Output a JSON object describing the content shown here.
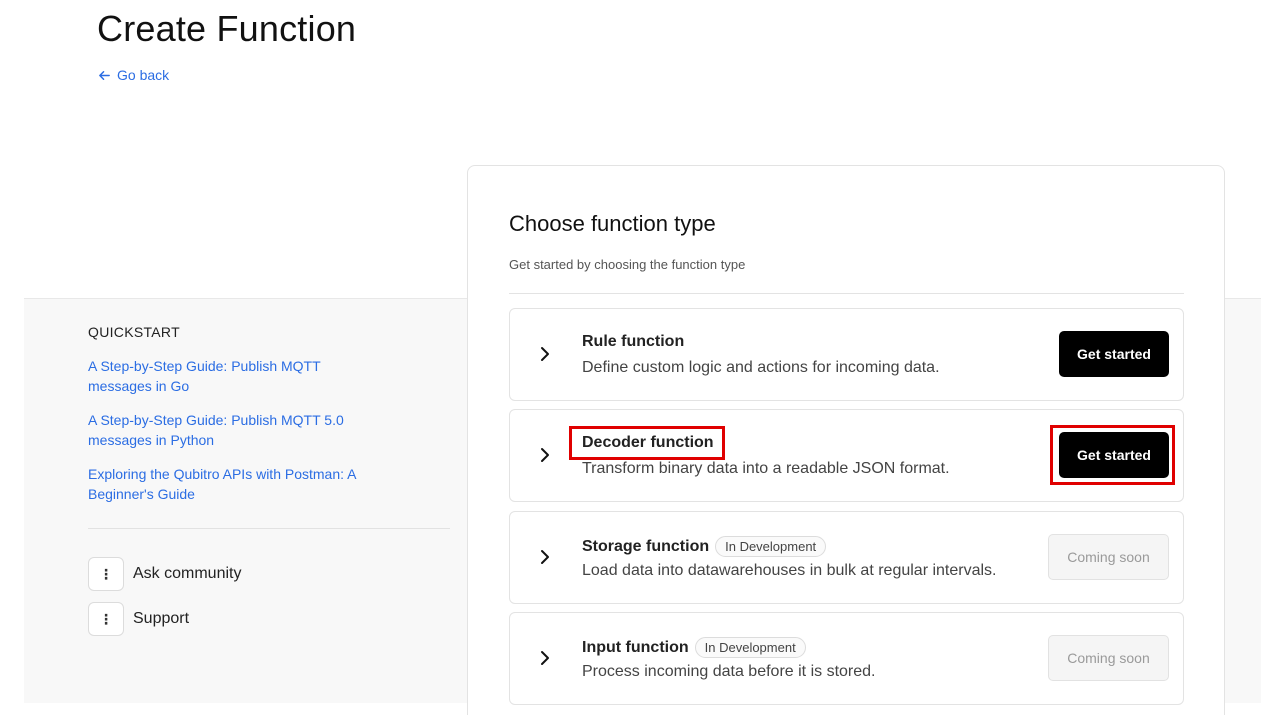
{
  "header": {
    "title": "Create Function",
    "go_back": "Go back"
  },
  "sidebar": {
    "quickstart_heading": "QUICKSTART",
    "links": [
      "A Step-by-Step Guide: Publish MQTT messages in Go",
      "A Step-by-Step Guide: Publish MQTT 5.0 messages in Python",
      "Exploring the Qubitro APIs with Postman: A Beginner's Guide"
    ],
    "actions": [
      {
        "label": "Ask community",
        "icon": "more-vertical-icon"
      },
      {
        "label": "Support",
        "icon": "more-vertical-icon"
      }
    ]
  },
  "card": {
    "title": "Choose function type",
    "subtitle": "Get started by choosing the function type",
    "functions": [
      {
        "title": "Rule function",
        "description": "Define custom logic and actions for incoming data.",
        "badge": "",
        "button": "Get started",
        "enabled": true
      },
      {
        "title": "Decoder function",
        "description": "Transform binary data into a readable JSON format.",
        "badge": "",
        "button": "Get started",
        "enabled": true
      },
      {
        "title": "Storage function",
        "description": "Load data into datawarehouses in bulk at regular intervals.",
        "badge": "In Development",
        "button": "Coming soon",
        "enabled": false
      },
      {
        "title": "Input function",
        "description": "Process incoming data before it is stored.",
        "badge": "In Development",
        "button": "Coming soon",
        "enabled": false
      }
    ]
  },
  "colors": {
    "link": "#2b6de3",
    "primary_button": "#000000",
    "highlight": "#e00000"
  }
}
